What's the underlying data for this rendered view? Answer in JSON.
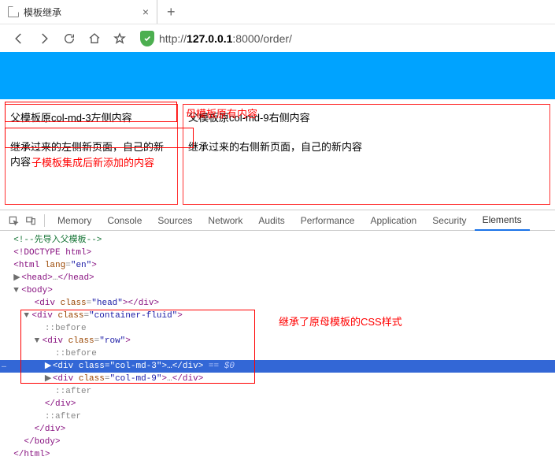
{
  "browser": {
    "tab_title": "模板继承",
    "tab_close": "×",
    "tab_add": "+",
    "url_prefix": "http://",
    "url_host": "127.0.0.1",
    "url_suffix": ":8000/order/"
  },
  "page": {
    "left_line1": "父模板原col-md-3左侧内容",
    "left_line2": "继承过来的左侧新页面，自己的新内容",
    "right_line1": "父模板原col-md-9右侧内容",
    "right_line2": "继承过来的右侧新页面，自己的新内容"
  },
  "annotations": {
    "label1": "母模板原有内容",
    "label2": "子模板集成后新添加的内容",
    "label3": "继承了原母模板的CSS样式"
  },
  "devtools": {
    "tabs": {
      "memory": "Memory",
      "console": "Console",
      "sources": "Sources",
      "network": "Network",
      "audits": "Audits",
      "performance": "Performance",
      "application": "Application",
      "security": "Security",
      "elements": "Elements"
    },
    "tree": {
      "comment": "<!--先导入父模板-->",
      "doctype": "<!DOCTYPE html>",
      "html_open": "<html lang=\"en\">",
      "head": "<head>…</head>",
      "body_open": "<body>",
      "div_head": "<div class=\"head\"></div>",
      "div_cf_open": "<div class=\"container-fluid\">",
      "before": "::before",
      "div_row_open": "<div class=\"row\">",
      "div_col3": "<div class=\"col-md-3\">…</div>",
      "selected_suffix": " == $0",
      "div_col9": "<div class=\"col-md-9\">…</div>",
      "after": "::after",
      "div_close": "</div>",
      "body_close": "</body>",
      "html_close": "</html>"
    },
    "marker": "…"
  }
}
